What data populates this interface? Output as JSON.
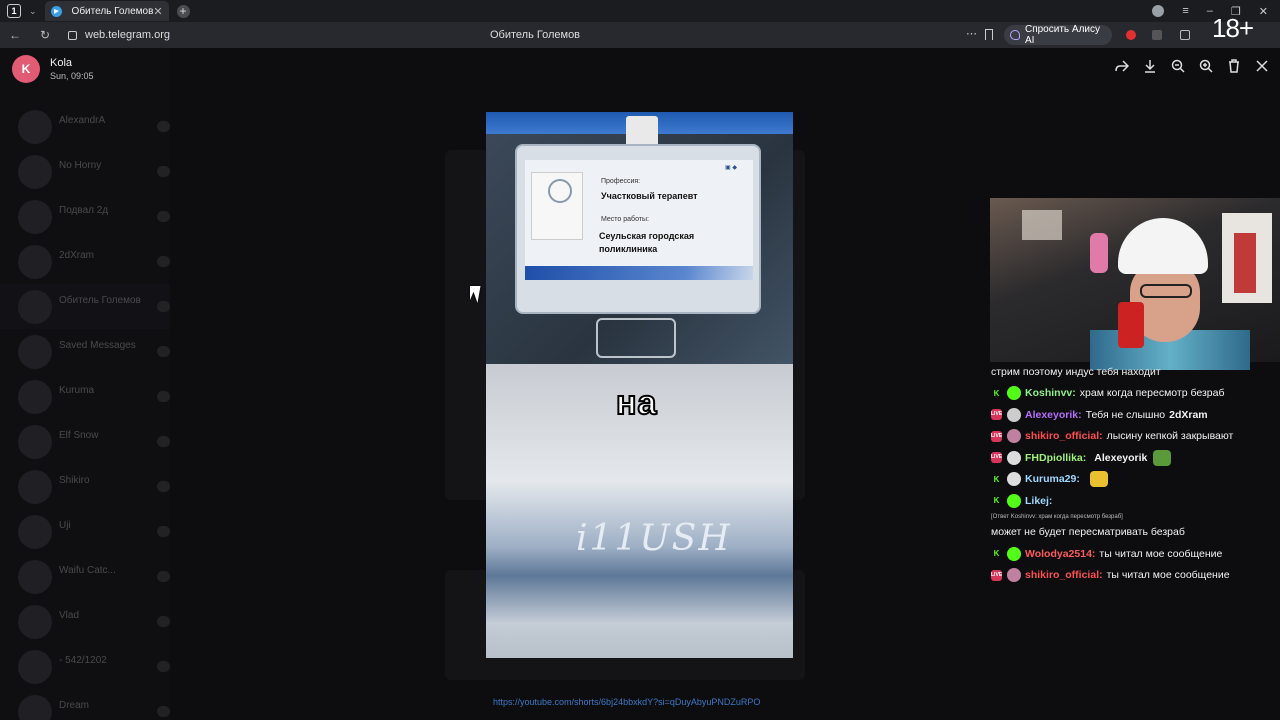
{
  "browser": {
    "tab_count": "1",
    "tab_title": "Обитель Големов",
    "url": "web.telegram.org",
    "page_title": "Обитель Големов",
    "alice_button": "Спросить Алису AI",
    "age_badge": "18+"
  },
  "viewer": {
    "avatar_letter": "K",
    "sender": "Kola",
    "time": "Sun, 09:05",
    "source_link": "https://youtube.com/shorts/6bj24bbxkdY?si=qDuyAbyuPNDZuRPO"
  },
  "video": {
    "badge_profession_label": "Профессия:",
    "badge_profession": "Участковый терапевт",
    "badge_work_label": "Место работы:",
    "badge_work_line1": "Сеульская городская",
    "badge_work_line2": "поликлиника",
    "caption": "на",
    "watermark": "i11USH"
  },
  "sidebar": {
    "chats": [
      {
        "name": "AlexandrA"
      },
      {
        "name": "No Horny"
      },
      {
        "name": "Подвал 2д"
      },
      {
        "name": "2dXram"
      },
      {
        "name": "Обитель Големов"
      },
      {
        "name": "Saved Messages"
      },
      {
        "name": "Kuruma"
      },
      {
        "name": "Elf Snow"
      },
      {
        "name": "Shikiro"
      },
      {
        "name": "Uji"
      },
      {
        "name": "Waifu Catc..."
      },
      {
        "name": "Vlad"
      },
      {
        "name": "- 542/1202"
      },
      {
        "name": "Dream"
      }
    ]
  },
  "stream_chat": [
    {
      "platform": "none",
      "user": "",
      "user_color": "#ffffff",
      "text": "стрим поэтому индус тебя находит"
    },
    {
      "platform": "kick",
      "user": "Koshinvv:",
      "user_color": "#8ef08a",
      "text": "храм когда пересмотр безраб",
      "badge_color": "#53fc18"
    },
    {
      "platform": "live",
      "user": "Alexeyorik:",
      "user_color": "#b56cff",
      "text": "Тебя не слышно",
      "bold_tail": "2dXram",
      "badge_color": "#cccccc"
    },
    {
      "platform": "live",
      "user": "shikiro_official:",
      "user_color": "#ff4d4d",
      "text": "лысину кепкой закрывают",
      "badge_color": "#c080a0"
    },
    {
      "platform": "live",
      "user": "FHDpiollika:",
      "user_color": "#9ef07a",
      "text": "",
      "bold_tail": "Alexeyorik",
      "badge_color": "#dddddd"
    },
    {
      "platform": "kick",
      "user": "Kuruma29:",
      "user_color": "#9fd8ff",
      "text": "",
      "badge_color": "#dddddd"
    },
    {
      "platform": "kick",
      "user": "Likej:",
      "user_color": "#9fd8ff",
      "text": "",
      "badge_color": "#53fc18"
    },
    {
      "platform": "none",
      "user": "",
      "user_color": "#ffffff",
      "text": "может не будет пересматривать безраб",
      "reply": "[Ответ Koshinvv: храм когда пересмотр безраб]"
    },
    {
      "platform": "kick",
      "user": "Wolodya2514:",
      "user_color": "#ff5a5a",
      "text": "ты читал мое сообщение",
      "badge_color": "#53fc18"
    },
    {
      "platform": "live",
      "user": "shikiro_official:",
      "user_color": "#ff4d4d",
      "text": "ты читал мое сообщение",
      "badge_color": "#c080a0"
    }
  ]
}
